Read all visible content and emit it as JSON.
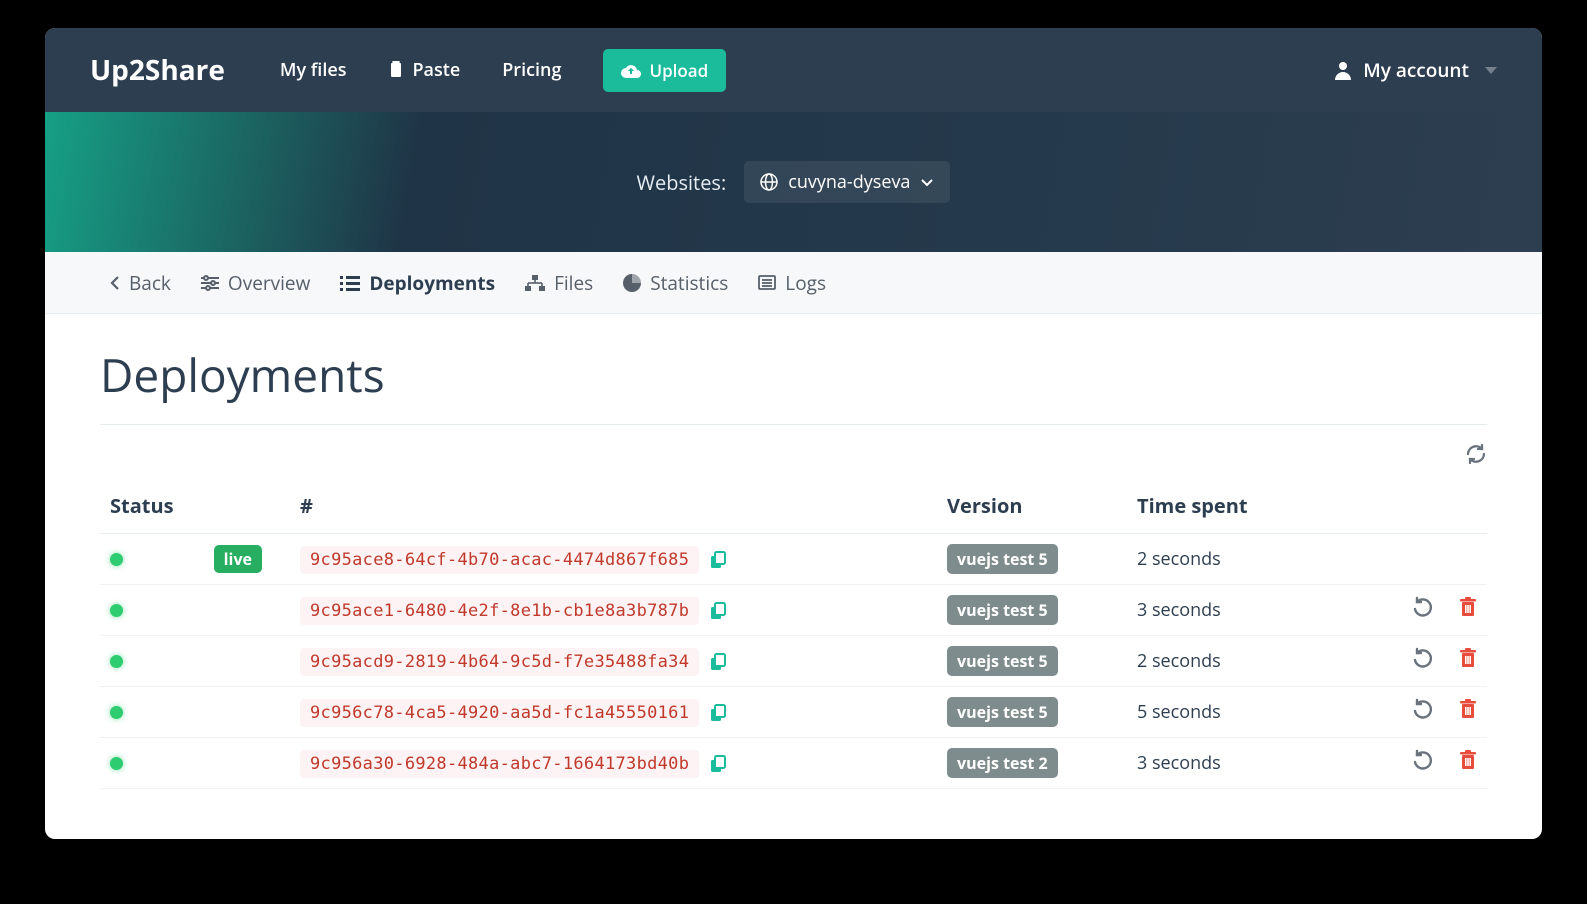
{
  "brand": "Up2Share",
  "nav": {
    "myfiles": "My files",
    "paste": "Paste",
    "pricing": "Pricing",
    "upload": "Upload",
    "account": "My account"
  },
  "hero": {
    "label": "Websites:",
    "selected": "cuvyna-dyseva"
  },
  "subnav": {
    "back": "Back",
    "overview": "Overview",
    "deployments": "Deployments",
    "files": "Files",
    "statistics": "Statistics",
    "logs": "Logs"
  },
  "page": {
    "title": "Deployments"
  },
  "table": {
    "headers": {
      "status": "Status",
      "hash": "#",
      "version": "Version",
      "time": "Time spent"
    },
    "rows": [
      {
        "live": true,
        "hash": "9c95ace8-64cf-4b70-acac-4474d867f685",
        "version": "vuejs test 5",
        "time": "2 seconds"
      },
      {
        "live": false,
        "hash": "9c95ace1-6480-4e2f-8e1b-cb1e8a3b787b",
        "version": "vuejs test 5",
        "time": "3 seconds"
      },
      {
        "live": false,
        "hash": "9c95acd9-2819-4b64-9c5d-f7e35488fa34",
        "version": "vuejs test 5",
        "time": "2 seconds"
      },
      {
        "live": false,
        "hash": "9c956c78-4ca5-4920-aa5d-fc1a45550161",
        "version": "vuejs test 5",
        "time": "5 seconds"
      },
      {
        "live": false,
        "hash": "9c956a30-6928-484a-abc7-1664173bd40b",
        "version": "vuejs test 2",
        "time": "3 seconds"
      }
    ],
    "live_label": "live"
  }
}
